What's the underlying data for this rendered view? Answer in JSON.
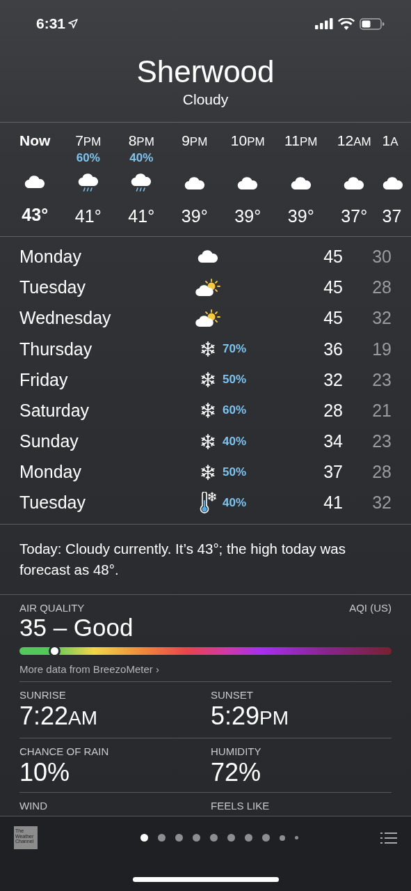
{
  "status_bar": {
    "time": "6:31"
  },
  "header": {
    "city": "Sherwood",
    "condition": "Cloudy"
  },
  "hourly": [
    {
      "hour": "Now",
      "kind": "cloud",
      "temp": "43°",
      "now": true
    },
    {
      "hour": "7",
      "period": "PM",
      "precip": "60%",
      "kind": "rain",
      "temp": "41°",
      "now": false
    },
    {
      "hour": "8",
      "period": "PM",
      "precip": "40%",
      "kind": "rain",
      "temp": "41°",
      "now": false
    },
    {
      "hour": "9",
      "period": "PM",
      "kind": "cloud",
      "temp": "39°",
      "now": false
    },
    {
      "hour": "10",
      "period": "PM",
      "kind": "cloud",
      "temp": "39°",
      "now": false
    },
    {
      "hour": "11",
      "period": "PM",
      "kind": "cloud",
      "temp": "39°",
      "now": false
    },
    {
      "hour": "12",
      "period": "AM",
      "kind": "cloud",
      "temp": "37°",
      "now": false
    },
    {
      "hour": "1",
      "period": "A",
      "kind": "cloud",
      "temp": "37",
      "now": false
    }
  ],
  "daily": [
    {
      "day": "Monday",
      "kind": "cloud",
      "high": "45",
      "low": "30"
    },
    {
      "day": "Tuesday",
      "kind": "partly-sunny",
      "high": "45",
      "low": "28"
    },
    {
      "day": "Wednesday",
      "kind": "partly-sunny",
      "high": "45",
      "low": "32"
    },
    {
      "day": "Thursday",
      "kind": "snow",
      "precip": "70%",
      "high": "36",
      "low": "19"
    },
    {
      "day": "Friday",
      "kind": "snow",
      "precip": "50%",
      "high": "32",
      "low": "23"
    },
    {
      "day": "Saturday",
      "kind": "snow",
      "precip": "60%",
      "high": "28",
      "low": "21"
    },
    {
      "day": "Sunday",
      "kind": "snow",
      "precip": "40%",
      "high": "34",
      "low": "23"
    },
    {
      "day": "Monday",
      "kind": "snow",
      "precip": "50%",
      "high": "37",
      "low": "28"
    },
    {
      "day": "Tuesday",
      "kind": "cold",
      "precip": "40%",
      "high": "41",
      "low": "32"
    }
  ],
  "summary": "Today: Cloudy currently. It’s 43°; the high today was forecast as 48°.",
  "air_quality": {
    "label": "AIR QUALITY",
    "scale": "AQI (US)",
    "value": "35 – Good",
    "level": 0.093,
    "link": "More data from BreezoMeter ›"
  },
  "details": [
    [
      {
        "label": "SUNRISE",
        "value": "7:22",
        "unit": "AM"
      },
      {
        "label": "SUNSET",
        "value": "5:29",
        "unit": "PM"
      }
    ],
    [
      {
        "label": "CHANCE OF RAIN",
        "value": "10%"
      },
      {
        "label": "HUMIDITY",
        "value": "72%"
      }
    ],
    [
      {
        "label": "WIND"
      },
      {
        "label": "FEELS LIKE"
      }
    ]
  ],
  "footer": {
    "logo": [
      "The",
      "Weather",
      "Channel"
    ],
    "pages": [
      {
        "selected": true
      },
      {
        "selected": false
      },
      {
        "selected": false
      },
      {
        "selected": false
      },
      {
        "selected": false
      },
      {
        "selected": false
      },
      {
        "selected": false
      },
      {
        "selected": false
      },
      {
        "selected": false
      },
      {
        "selected": false
      }
    ]
  }
}
